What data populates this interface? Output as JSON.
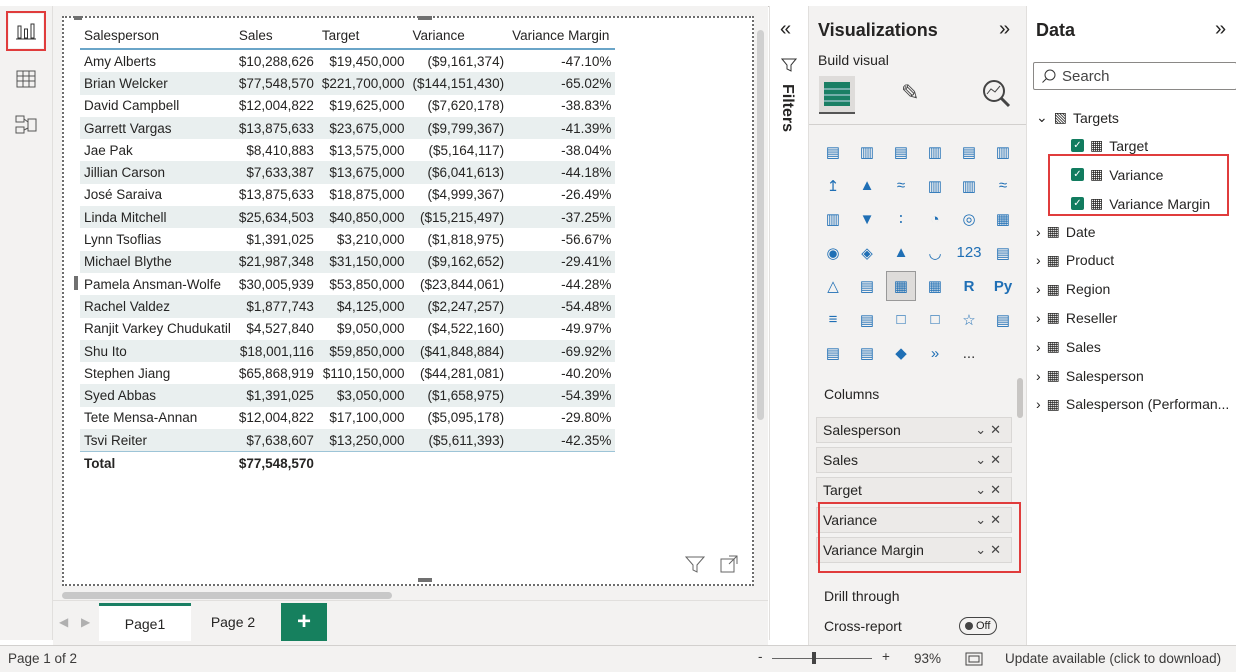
{
  "rail": {
    "report_icon": "bar-chart-icon",
    "table_icon": "table-icon",
    "model_icon": "model-icon"
  },
  "table": {
    "headers": [
      "Salesperson",
      "Sales",
      "Target",
      "Variance",
      "Variance Margin"
    ],
    "rows": [
      [
        "Amy Alberts",
        "$10,288,626",
        "$19,450,000",
        "($9,161,374)",
        "-47.10%"
      ],
      [
        "Brian Welcker",
        "$77,548,570",
        "$221,700,000",
        "($144,151,430)",
        "-65.02%"
      ],
      [
        "David Campbell",
        "$12,004,822",
        "$19,625,000",
        "($7,620,178)",
        "-38.83%"
      ],
      [
        "Garrett Vargas",
        "$13,875,633",
        "$23,675,000",
        "($9,799,367)",
        "-41.39%"
      ],
      [
        "Jae Pak",
        "$8,410,883",
        "$13,575,000",
        "($5,164,117)",
        "-38.04%"
      ],
      [
        "Jillian Carson",
        "$7,633,387",
        "$13,675,000",
        "($6,041,613)",
        "-44.18%"
      ],
      [
        "José Saraiva",
        "$13,875,633",
        "$18,875,000",
        "($4,999,367)",
        "-26.49%"
      ],
      [
        "Linda Mitchell",
        "$25,634,503",
        "$40,850,000",
        "($15,215,497)",
        "-37.25%"
      ],
      [
        "Lynn Tsoflias",
        "$1,391,025",
        "$3,210,000",
        "($1,818,975)",
        "-56.67%"
      ],
      [
        "Michael Blythe",
        "$21,987,348",
        "$31,150,000",
        "($9,162,652)",
        "-29.41%"
      ],
      [
        "Pamela Ansman-Wolfe",
        "$30,005,939",
        "$53,850,000",
        "($23,844,061)",
        "-44.28%"
      ],
      [
        "Rachel Valdez",
        "$1,877,743",
        "$4,125,000",
        "($2,247,257)",
        "-54.48%"
      ],
      [
        "Ranjit Varkey Chudukatil",
        "$4,527,840",
        "$9,050,000",
        "($4,522,160)",
        "-49.97%"
      ],
      [
        "Shu Ito",
        "$18,001,116",
        "$59,850,000",
        "($41,848,884)",
        "-69.92%"
      ],
      [
        "Stephen Jiang",
        "$65,868,919",
        "$110,150,000",
        "($44,281,081)",
        "-40.20%"
      ],
      [
        "Syed Abbas",
        "$1,391,025",
        "$3,050,000",
        "($1,658,975)",
        "-54.39%"
      ],
      [
        "Tete Mensa-Annan",
        "$12,004,822",
        "$17,100,000",
        "($5,095,178)",
        "-29.80%"
      ],
      [
        "Tsvi Reiter",
        "$7,638,607",
        "$13,250,000",
        "($5,611,393)",
        "-42.35%"
      ]
    ],
    "total": [
      "Total",
      "$77,548,570",
      "",
      "",
      ""
    ]
  },
  "pages": {
    "page1": "Page1",
    "page2": "Page 2",
    "add": "+"
  },
  "status": {
    "page_info": "Page 1 of 2",
    "zoom_minus": "-",
    "zoom_plus": "+",
    "zoom": "93%",
    "update": "Update available (click to download)"
  },
  "filters": {
    "label": "Filters",
    "collapse": "«"
  },
  "viz": {
    "title": "Visualizations",
    "expand": "»",
    "build_visual": "Build visual",
    "more": "...",
    "columns_label": "Columns",
    "wells": [
      "Salesperson",
      "Sales",
      "Target",
      "Variance",
      "Variance Margin"
    ],
    "drill_through": "Drill through",
    "cross_report": "Cross-report",
    "toggle": "Off",
    "r_label": "R",
    "py_label": "Py"
  },
  "data": {
    "title": "Data",
    "expand": "»",
    "search_placeholder": "Search",
    "targets": "Targets",
    "target_fields": [
      "Target",
      "Variance",
      "Variance Margin"
    ],
    "tables": [
      "Date",
      "Product",
      "Region",
      "Reseller",
      "Sales",
      "Salesperson",
      "Salesperson (Performan..."
    ]
  },
  "colors": {
    "accent": "#16805e",
    "highlight": "#e03c3c",
    "header_rule": "#6aa5c8"
  }
}
